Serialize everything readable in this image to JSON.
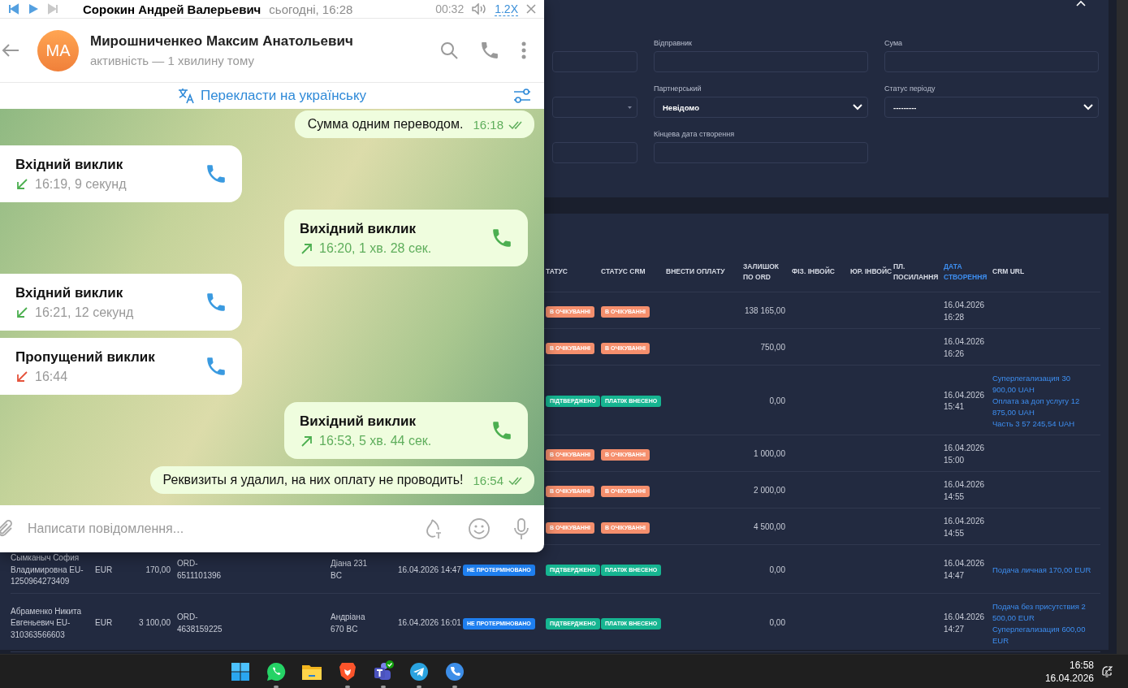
{
  "telegram": {
    "player": {
      "title": "Сорокин Андрей Валерьевич",
      "subtitle": "сьогодні, 16:28",
      "time": "00:32",
      "speed": "1.2X"
    },
    "chat": {
      "initials": "MA",
      "name": "Мирошниченкео Максим Анатольевич",
      "status": "активність — 1 хвилину тому"
    },
    "translate": "Перекласти на українську",
    "messages": [
      {
        "kind": "text",
        "text": "Сумма одним переводом.",
        "time": "16:18",
        "read": true
      },
      {
        "kind": "incoming-call",
        "title": "Вхідний виклик",
        "detail": "16:19, 9 секунд"
      },
      {
        "kind": "outgoing-call",
        "title": "Вихідний виклик",
        "detail": "16:20, 1 хв. 28 сек."
      },
      {
        "kind": "incoming-call",
        "title": "Вхідний виклик",
        "detail": "16:21, 12 секунд"
      },
      {
        "kind": "missed-call",
        "title": "Пропущений виклик",
        "detail": "16:44"
      },
      {
        "kind": "outgoing-call",
        "title": "Вихідний виклик",
        "detail": "16:53, 5 хв. 44 сек."
      },
      {
        "kind": "text",
        "text": "Реквизиты я удалил, на них оплату не проводить!",
        "time": "16:54",
        "read": true
      }
    ],
    "composer": {
      "placeholder": "Написати повідомлення..."
    }
  },
  "filters": {
    "fields": [
      {
        "kind": "input"
      },
      {
        "kind": "input",
        "label": "Відправник"
      },
      {
        "kind": "input",
        "label": "Сума"
      },
      {
        "kind": "select-small"
      },
      {
        "kind": "select",
        "label": "Партнерський",
        "value": "Невідомо"
      },
      {
        "kind": "select",
        "label": "Статус періоду",
        "value": "---------"
      },
      {
        "kind": "input"
      },
      {
        "kind": "input",
        "label": "Кінцева дата створення"
      }
    ]
  },
  "table": {
    "columns": [
      {
        "label": "ТАТУС",
        "sorted": false
      },
      {
        "label": "СТАТУС CRM",
        "sorted": false
      },
      {
        "label": "ВНЕСТИ ОПЛАТУ",
        "sorted": false
      },
      {
        "label": "ЗАЛИШОК ПО ORD",
        "sorted": false
      },
      {
        "label": "ФІЗ. ІНВОЙС",
        "sorted": false
      },
      {
        "label": "ЮР. ІНВОЙС",
        "sorted": false
      },
      {
        "label": "ПЛ. ПОСИЛАННЯ",
        "sorted": false
      },
      {
        "label": "ДАТА СТВОРЕННЯ",
        "sorted": true
      },
      {
        "label": "CRM URL",
        "sorted": false
      }
    ],
    "rows": [
      {
        "status": {
          "label": "В ОЧІКУВАННІ",
          "color": "#f58f6d"
        },
        "crm_status": {
          "label": "В ОЧІКУВАННІ",
          "color": "#f58f6d"
        },
        "balance": "138 165,00",
        "created": "16.04.2026 16:28"
      },
      {
        "status": {
          "label": "В ОЧІКУВАННІ",
          "color": "#f58f6d"
        },
        "crm_status": {
          "label": "В ОЧІКУВАННІ",
          "color": "#f58f6d"
        },
        "balance": "750,00",
        "created": "16.04.2026 16:26"
      },
      {
        "status": {
          "label": "ПІДТВЕРДЖЕНО",
          "color": "#16b591"
        },
        "crm_status": {
          "label": "ПЛАТІЖ ВНЕСЕНО",
          "color": "#16b591"
        },
        "balance": "0,00",
        "created": "16.04.2026 15:41",
        "crm_url": [
          "Суперлегализация 30 900,00 UAH",
          "Оплата за доп услугу 12 875,00 UAH",
          "Часть 3 57 245,54 UAH"
        ]
      },
      {
        "status": {
          "label": "В ОЧІКУВАННІ",
          "color": "#f58f6d"
        },
        "crm_status": {
          "label": "В ОЧІКУВАННІ",
          "color": "#f58f6d"
        },
        "balance": "1 000,00",
        "created": "16.04.2026 15:00"
      },
      {
        "status": {
          "label": "В ОЧІКУВАННІ",
          "color": "#f58f6d"
        },
        "crm_status": {
          "label": "В ОЧІКУВАННІ",
          "color": "#f58f6d"
        },
        "balance": "2 000,00",
        "created": "16.04.2026 14:55"
      },
      {
        "status": {
          "label": "В ОЧІКУВАННІ",
          "color": "#f58f6d"
        },
        "crm_status": {
          "label": "В ОЧІКУВАННІ",
          "color": "#f58f6d"
        },
        "balance": "4 500,00",
        "created": "16.04.2026 14:55"
      },
      {
        "client": "Сымканыч София Владимировна EU-1250964273409",
        "currency": "EUR",
        "amount": "170,00",
        "order": "ORD-6511101396",
        "manager": "Діана 231 BC",
        "date": "16.04.2026 14:47",
        "term_status": {
          "label": "НЕ ПРОТЕРМІНОВАНО",
          "color": "#1e7ff0"
        },
        "status": {
          "label": "ПІДТВЕРДЖЕНО",
          "color": "#16b591"
        },
        "crm_status": {
          "label": "ПЛАТІЖ ВНЕСЕНО",
          "color": "#16b591"
        },
        "balance": "0,00",
        "created": "16.04.2026 14:47",
        "crm_url": [
          "Подача личная 170,00 EUR"
        ]
      },
      {
        "client": "Абраменко Никита Евгеньевич EU-310363566603",
        "currency": "EUR",
        "amount": "3 100,00",
        "order": "ORD-4638159225",
        "manager": "Андріана 670 BC",
        "date": "16.04.2026 16:01",
        "term_status": {
          "label": "НЕ ПРОТЕРМІНОВАНО",
          "color": "#1e7ff0"
        },
        "status": {
          "label": "ПІДТВЕРДЖЕНО",
          "color": "#16b591"
        },
        "crm_status": {
          "label": "ПЛАТІЖ ВНЕСЕНО",
          "color": "#16b591"
        },
        "balance": "0,00",
        "created": "16.04.2026 14:27",
        "crm_url": [
          "Подача без присутствия 2 500,00 EUR",
          "Суперлегализация 600,00 EUR"
        ]
      }
    ]
  },
  "taskbar": {
    "apps": [
      {
        "kind": "start",
        "running": false
      },
      {
        "kind": "whatsapp",
        "running": true
      },
      {
        "kind": "folder",
        "running": false
      },
      {
        "kind": "brave",
        "running": true
      },
      {
        "kind": "teams",
        "running": true
      },
      {
        "kind": "telegram",
        "running": true
      },
      {
        "kind": "phone",
        "running": true
      }
    ],
    "time": "16:58",
    "date": "16.04.2026"
  }
}
